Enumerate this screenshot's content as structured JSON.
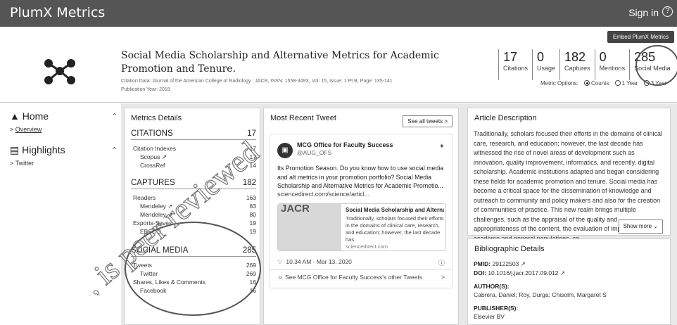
{
  "app": {
    "brand": "PlumX Metrics",
    "signin": "Sign in",
    "help": "?"
  },
  "toolbar": {
    "embed_label": "Embed PlumX Metrics"
  },
  "article": {
    "title_line1": "Social Media Scholarship and Alternative Metrics for Academic",
    "title_line2": "Promotion and Tenure.",
    "citation_data": "Citation Data: Journal of the American College of Radiology : JACR, ISSN: 1558-349X, Vol: 15, Issue: 1 Pt B, Page: 135-141",
    "pub_year": "Publication Year: 2018"
  },
  "stats": [
    {
      "num": "17",
      "label": "Citations"
    },
    {
      "num": "0",
      "label": "Usage"
    },
    {
      "num": "182",
      "label": "Captures"
    },
    {
      "num": "0",
      "label": "Mentions"
    },
    {
      "num": "285",
      "label": "Social Media"
    }
  ],
  "metric_options": {
    "label": "Metric Options:",
    "opt1": "Counts",
    "opt2": "1 Year",
    "opt3": "3 Year"
  },
  "sidebar": {
    "home": "Home",
    "overview": "Overview",
    "highlights": "Highlights",
    "twitter": "Twitter"
  },
  "metrics": {
    "title": "Metrics Details",
    "citations": {
      "label": "CITATIONS",
      "value": "17",
      "rows": [
        {
          "label": "Citation Indexes",
          "value": "17"
        },
        {
          "label": "Scopus ↗",
          "value": "17"
        },
        {
          "label": "CrossRef",
          "value": "14"
        }
      ]
    },
    "captures": {
      "label": "CAPTURES",
      "value": "182",
      "rows": [
        {
          "label": "Readers",
          "value": "163"
        },
        {
          "label": "Mendeley ↗",
          "value": "83"
        },
        {
          "label": "Mendeley ↗",
          "value": "80"
        },
        {
          "label": "Exports-Saves",
          "value": "19"
        },
        {
          "label": "EBSCO",
          "value": "19"
        }
      ]
    },
    "social": {
      "label": "SOCIAL MEDIA",
      "value": "285",
      "rows": [
        {
          "label": "Tweets",
          "value": "269"
        },
        {
          "label": "Twitter",
          "value": "269"
        },
        {
          "label": "Shares, Likes & Comments",
          "value": "16"
        },
        {
          "label": "Facebook",
          "value": "16"
        }
      ]
    }
  },
  "tweet": {
    "panel_title": "Most Recent Tweet",
    "see_all": "See all tweets",
    "author": "MCG Office for Faculty Success",
    "handle": "@AUG_OFS",
    "text": "Its Promotion Season. Do you know how to use social media and alt metrics in your promotion portfolio? Social Media Scholarship and Alternative Metrics for Academic Promotio...",
    "link": "sciencedirect.com/science/articl...",
    "card_title": "Social Media Scholarship and Alternative...",
    "card_text": "Traditionally, scholars focused their efforts in the domains of clinical care, research, and education; however, the last decade has",
    "card_domain": "sciencedirect.com",
    "card_thumb": "JACR",
    "time": "10.34 AM - Mar 13, 2020",
    "see_more": "See MCG Office for Faculty Success's other Tweets"
  },
  "description": {
    "title": "Article Description",
    "text": "Traditionally, scholars focused their efforts in the domains of clinical care, research, and education; however, the last decade has witnessed the rise of novel areas of development such as innovation, quality improvement, informatics, and recently, digital scholarship. Academic institutions adapted and began considering these fields for academic promotion and tenure. Social media has become a critical space for the dissemination of knowledge and outreach to community and policy makers and also for the creation of communities of practice. This new realm brings multiple challenges, such as the appraisal of the quality and appropriateness of the content, the evaluation of impact on the academe and general populations, co",
    "show_more": "Show more"
  },
  "bibliographic": {
    "title": "Bibliographic Details",
    "pmid_label": "PMID:",
    "pmid": "29122503 ↗",
    "doi_label": "DOI:",
    "doi": "10.1016/j.jacr.2017.09.012 ↗",
    "authors_label": "AUTHOR(S):",
    "authors": "Cabrera, Daniel; Roy, Durga; Chisolm, Margaret S",
    "publisher_label": "PUBLISHER(S):",
    "publisher": "Elsevier BV"
  },
  "watermark": "..., is peer reviewed, ..."
}
